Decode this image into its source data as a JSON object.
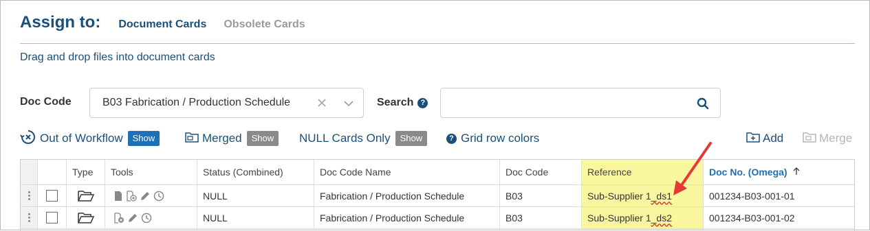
{
  "header": {
    "title": "Assign to:",
    "tabs": [
      {
        "label": "Document Cards",
        "active": true
      },
      {
        "label": "Obsolete Cards",
        "active": false
      }
    ]
  },
  "hint": "Drag and drop files into document cards",
  "filters": {
    "doc_code_label": "Doc Code",
    "doc_code_value": "B03 Fabrication / Production Schedule",
    "search_label": "Search",
    "search_value": ""
  },
  "toolbar": {
    "out_of_workflow": {
      "label": "Out of Workflow",
      "badge": "Show"
    },
    "merged": {
      "label": "Merged",
      "badge": "Show"
    },
    "null_cards": {
      "label": "NULL Cards Only",
      "badge": "Show"
    },
    "grid_row_colors": "Grid row colors",
    "add": "Add",
    "merge": "Merge"
  },
  "table": {
    "columns": [
      "Type",
      "Tools",
      "Status (Combined)",
      "Doc Code Name",
      "Doc Code",
      "Reference",
      "Doc No. (Omega)"
    ],
    "sort_column": "Doc No. (Omega)",
    "rows": [
      {
        "status": "NULL",
        "doc_code_name": "Fabrication / Production Schedule",
        "doc_code": "B03",
        "reference_prefix": "Sub-Supplier 1",
        "reference_suffix": "_ds1",
        "doc_no": "001234-B03-001-01"
      },
      {
        "status": "NULL",
        "doc_code_name": "Fabrication / Production Schedule",
        "doc_code": "B03",
        "reference_prefix": "Sub-Supplier 1",
        "reference_suffix": "_ds2",
        "doc_no": "001234-B03-001-02"
      }
    ]
  },
  "colors": {
    "primary": "#1a4f7a",
    "badge_blue": "#1e6fb5",
    "badge_gray": "#8a8a8a",
    "reference_highlight": "#faf7a0",
    "annotation_arrow": "#e53935"
  }
}
